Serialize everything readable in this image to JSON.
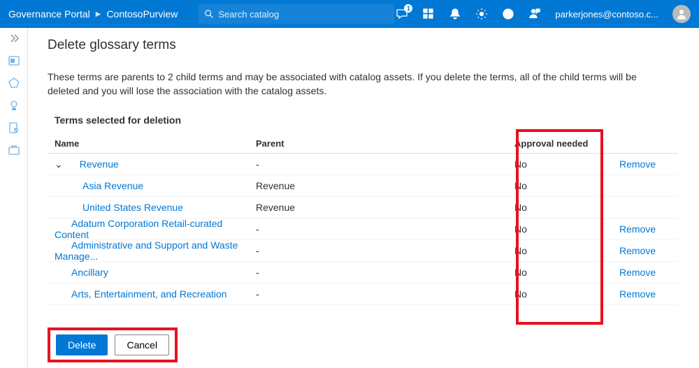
{
  "header": {
    "portal": "Governance Portal",
    "workspace": "ContosoPurview",
    "search_placeholder": "Search catalog",
    "notification_badge": "1",
    "user_email": "parkerjones@contoso.c..."
  },
  "page": {
    "title": "Delete glossary terms",
    "warning": "These terms are parents to 2 child terms and may be associated with catalog assets. If you delete the terms, all of the child terms will be deleted and you will lose the association with the catalog assets.",
    "section": "Terms selected for deletion"
  },
  "table": {
    "cols": {
      "name": "Name",
      "parent": "Parent",
      "approval": "Approval needed"
    },
    "rows": [
      {
        "level": 0,
        "expandable": true,
        "name": "Revenue",
        "parent": "-",
        "approval": "No",
        "remove": "Remove"
      },
      {
        "level": 1,
        "name": "Asia Revenue",
        "parent": "Revenue",
        "approval": "No",
        "remove": ""
      },
      {
        "level": 1,
        "name": "United States Revenue",
        "parent": "Revenue",
        "approval": "No",
        "remove": ""
      },
      {
        "level": 0,
        "name": "Adatum Corporation Retail-curated Content",
        "parent": "-",
        "approval": "No",
        "remove": "Remove"
      },
      {
        "level": 0,
        "name": "Administrative and Support and Waste Manage...",
        "parent": "-",
        "approval": "No",
        "remove": "Remove"
      },
      {
        "level": 0,
        "name": "Ancillary",
        "parent": "-",
        "approval": "No",
        "remove": "Remove"
      },
      {
        "level": 0,
        "name": "Arts, Entertainment, and Recreation",
        "parent": "-",
        "approval": "No",
        "remove": "Remove"
      }
    ]
  },
  "footer": {
    "delete": "Delete",
    "cancel": "Cancel"
  }
}
